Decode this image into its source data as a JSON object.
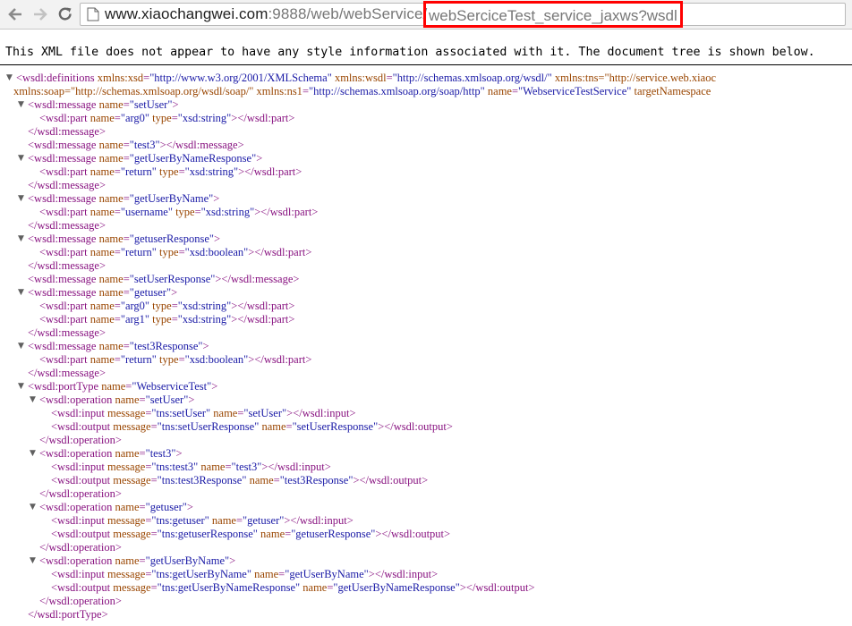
{
  "browser": {
    "url_host": "www.xiaochangwei.com",
    "url_port_path": ":9888/web/webService/",
    "url_highlighted": "webSerciceTest_service_jaxws?wsdl",
    "icons": {
      "back": "back-arrow-icon",
      "forward": "forward-arrow-icon",
      "reload": "reload-icon",
      "page": "page-icon"
    }
  },
  "info_text": "This XML file does not appear to have any style information associated with it. The document tree is shown below.",
  "colors": {
    "tag": "#881280",
    "attr_name": "#994500",
    "attr_value": "#1a1aa6",
    "highlight": "#ff0000"
  },
  "lines": [
    {
      "t": "<wsdl:definitions xmlns:xsd=\"http://www.w3.org/2001/XMLSchema\" xmlns:wsdl=\"http://schemas.xmlsoap.org/wsdl/\" xmlns:tns=\"http://service.web.xiaoc"
    },
    {
      "t": "xmlns:soap=\"http://schemas.xmlsoap.org/wsdl/soap/\" xmlns:ns1=\"http://schemas.xmlsoap.org/soap/http\" name=\"WebserviceTestService\" targetNamespace"
    },
    {
      "t": "<wsdl:message name=\"setUser\">"
    },
    {
      "t": "<wsdl:part name=\"arg0\" type=\"xsd:string\"></wsdl:part>"
    },
    {
      "t": "</wsdl:message>"
    },
    {
      "t": "<wsdl:message name=\"test3\"></wsdl:message>"
    },
    {
      "t": "<wsdl:message name=\"getUserByNameResponse\">"
    },
    {
      "t": "<wsdl:part name=\"return\" type=\"xsd:string\"></wsdl:part>"
    },
    {
      "t": "</wsdl:message>"
    },
    {
      "t": "<wsdl:message name=\"getUserByName\">"
    },
    {
      "t": "<wsdl:part name=\"username\" type=\"xsd:string\"></wsdl:part>"
    },
    {
      "t": "</wsdl:message>"
    },
    {
      "t": "<wsdl:message name=\"getuserResponse\">"
    },
    {
      "t": "<wsdl:part name=\"return\" type=\"xsd:boolean\"></wsdl:part>"
    },
    {
      "t": "</wsdl:message>"
    },
    {
      "t": "<wsdl:message name=\"setUserResponse\"></wsdl:message>"
    },
    {
      "t": "<wsdl:message name=\"getuser\">"
    },
    {
      "t": "<wsdl:part name=\"arg0\" type=\"xsd:string\"></wsdl:part>"
    },
    {
      "t": "<wsdl:part name=\"arg1\" type=\"xsd:string\"></wsdl:part>"
    },
    {
      "t": "</wsdl:message>"
    },
    {
      "t": "<wsdl:message name=\"test3Response\">"
    },
    {
      "t": "<wsdl:part name=\"return\" type=\"xsd:boolean\"></wsdl:part>"
    },
    {
      "t": "</wsdl:message>"
    },
    {
      "t": "<wsdl:portType name=\"WebserviceTest\">"
    },
    {
      "t": "<wsdl:operation name=\"setUser\">"
    },
    {
      "t": "<wsdl:input message=\"tns:setUser\" name=\"setUser\"></wsdl:input>"
    },
    {
      "t": "<wsdl:output message=\"tns:setUserResponse\" name=\"setUserResponse\"></wsdl:output>"
    },
    {
      "t": "</wsdl:operation>"
    },
    {
      "t": "<wsdl:operation name=\"test3\">"
    },
    {
      "t": "<wsdl:input message=\"tns:test3\" name=\"test3\"></wsdl:input>"
    },
    {
      "t": "<wsdl:output message=\"tns:test3Response\" name=\"test3Response\"></wsdl:output>"
    },
    {
      "t": "</wsdl:operation>"
    },
    {
      "t": "<wsdl:operation name=\"getuser\">"
    },
    {
      "t": "<wsdl:input message=\"tns:getuser\" name=\"getuser\"></wsdl:input>"
    },
    {
      "t": "<wsdl:output message=\"tns:getuserResponse\" name=\"getuserResponse\"></wsdl:output>"
    },
    {
      "t": "</wsdl:operation>"
    },
    {
      "t": "<wsdl:operation name=\"getUserByName\">"
    },
    {
      "t": "<wsdl:input message=\"tns:getUserByName\" name=\"getUserByName\"></wsdl:input>"
    },
    {
      "t": "<wsdl:output message=\"tns:getUserByNameResponse\" name=\"getUserByNameResponse\"></wsdl:output>"
    },
    {
      "t": "</wsdl:operation>"
    },
    {
      "t": "</wsdl:portType>"
    }
  ]
}
